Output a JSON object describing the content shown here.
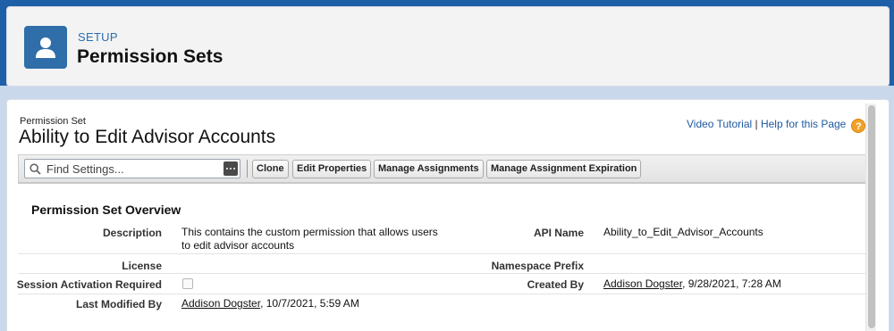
{
  "header": {
    "section": "SETUP",
    "title": "Permission Sets",
    "icon": "user-icon"
  },
  "record": {
    "type_label": "Permission Set",
    "title": "Ability to Edit Advisor Accounts"
  },
  "help": {
    "video_tutorial": "Video Tutorial",
    "separator": " | ",
    "help_page": "Help for this Page",
    "help_icon_glyph": "?"
  },
  "toolbar": {
    "search_placeholder": "Find Settings...",
    "buttons": {
      "clone": "Clone",
      "edit_properties": "Edit Properties",
      "manage_assignments": "Manage Assignments",
      "manage_assignment_expiration": "Manage Assignment Expiration"
    }
  },
  "overview": {
    "title": "Permission Set Overview",
    "description_label": "Description",
    "description_value": "This contains the custom permission that allows users to edit advisor accounts",
    "api_name_label": "API Name",
    "api_name_value": "Ability_to_Edit_Advisor_Accounts",
    "license_label": "License",
    "license_value": "",
    "namespace_label": "Namespace Prefix",
    "namespace_value": "",
    "session_label": "Session Activation Required",
    "session_checked": false,
    "created_by_label": "Created By",
    "created_by_user": "Addison Dogster",
    "created_by_date": ", 9/28/2021, 7:28 AM",
    "modified_by_label": "Last Modified By",
    "modified_by_user": "Addison Dogster",
    "modified_by_date": ", 10/7/2021, 5:59 AM"
  },
  "colors": {
    "brand_blue": "#2f6ea8",
    "link_blue": "#1f5aa0",
    "help_orange": "#f1a12b"
  }
}
